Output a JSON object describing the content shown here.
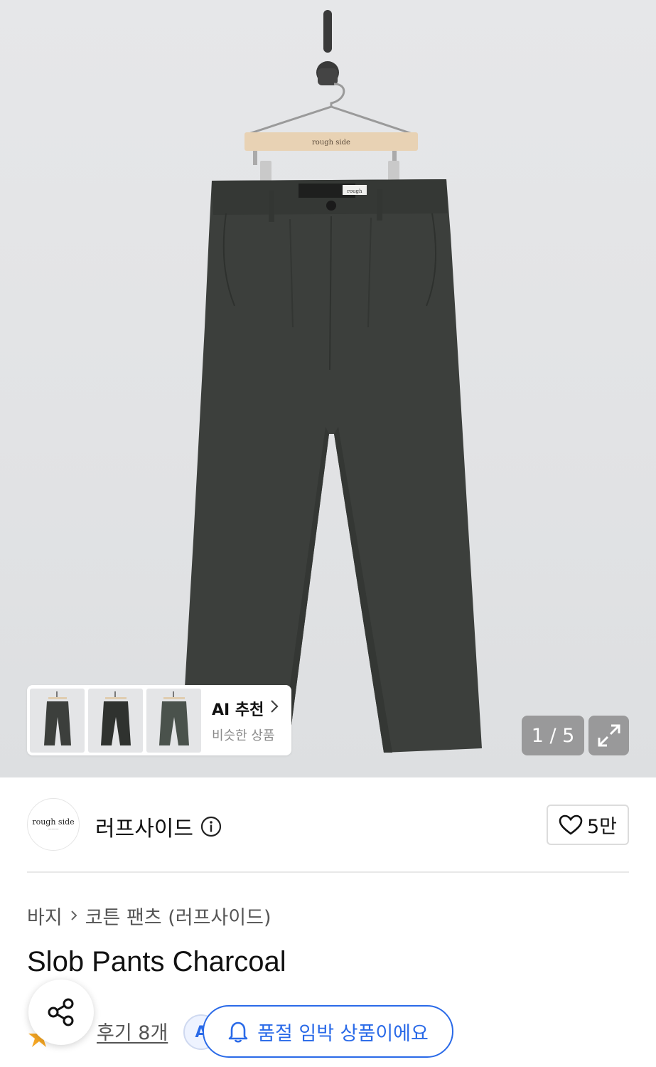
{
  "hero": {
    "hanger_label": "rough side",
    "waist_tag": "rough",
    "pager": "1 / 5"
  },
  "ai_reco": {
    "title": "AI 추천",
    "subtitle": "비슷한 상품"
  },
  "brand": {
    "logo_text": "rough side",
    "name": "러프사이드",
    "likes": "5만"
  },
  "breadcrumb": {
    "category": "바지",
    "subcategory": "코튼 팬츠 (러프사이드)"
  },
  "product": {
    "title": "Slob Pants Charcoal"
  },
  "reviews": {
    "label": "후기 8개",
    "ai_badge": "A"
  },
  "notify": {
    "label": "품절 임박 상품이에요"
  },
  "colors": {
    "accent": "#2a6ae8",
    "pants": "#3c3f3c"
  }
}
